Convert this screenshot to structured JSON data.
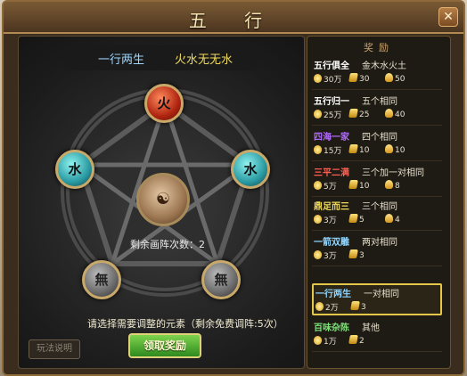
{
  "title": "五 行",
  "close_label": "✕",
  "banner": {
    "left": "一行两生",
    "right": "火水无无水"
  },
  "orbs": {
    "top": "火",
    "left": "水",
    "right": "水",
    "bottom_left": "無",
    "bottom_right": "無",
    "center": "☯"
  },
  "remaining_label": "剩余画阵次数：2",
  "hint": "请选择需要调整的元素（剩余免费调阵:5次）",
  "help_button": "玩法说明",
  "claim_button": "领取奖励",
  "rewards_header": "奖励",
  "rewards": [
    {
      "name": "五行俱全",
      "cond": "金木水火土",
      "color": "#ffffff",
      "r1": "30万",
      "r2": "30",
      "r3": "50"
    },
    {
      "name": "五行归一",
      "cond": "五个相同",
      "color": "#ffffff",
      "r1": "25万",
      "r2": "25",
      "r3": "40"
    },
    {
      "name": "四海一家",
      "cond": "四个相同",
      "color": "#b26bff",
      "r1": "15万",
      "r2": "10",
      "r3": "10"
    },
    {
      "name": "三平二满",
      "cond": "三个加一对相同",
      "color": "#ff5f52",
      "r1": "5万",
      "r2": "10",
      "r3": "8"
    },
    {
      "name": "鼎足而三",
      "cond": "三个相同",
      "color": "#f2dc5c",
      "r1": "3万",
      "r2": "5",
      "r3": "4"
    },
    {
      "name": "一箭双雕",
      "cond": "两对相同",
      "color": "#8fd5ff",
      "r1": "3万",
      "r2": "3",
      "r3": ""
    },
    {
      "name": "一行两生",
      "cond": "一对相同",
      "color": "#8fd5ff",
      "r1": "2万",
      "r2": "3",
      "r3": ""
    },
    {
      "name": "百味杂陈",
      "cond": "其他",
      "color": "#7fe07a",
      "r1": "1万",
      "r2": "2",
      "r3": ""
    }
  ],
  "colors": {
    "accent": "#e3c64a",
    "panel": "#1e1a14"
  }
}
